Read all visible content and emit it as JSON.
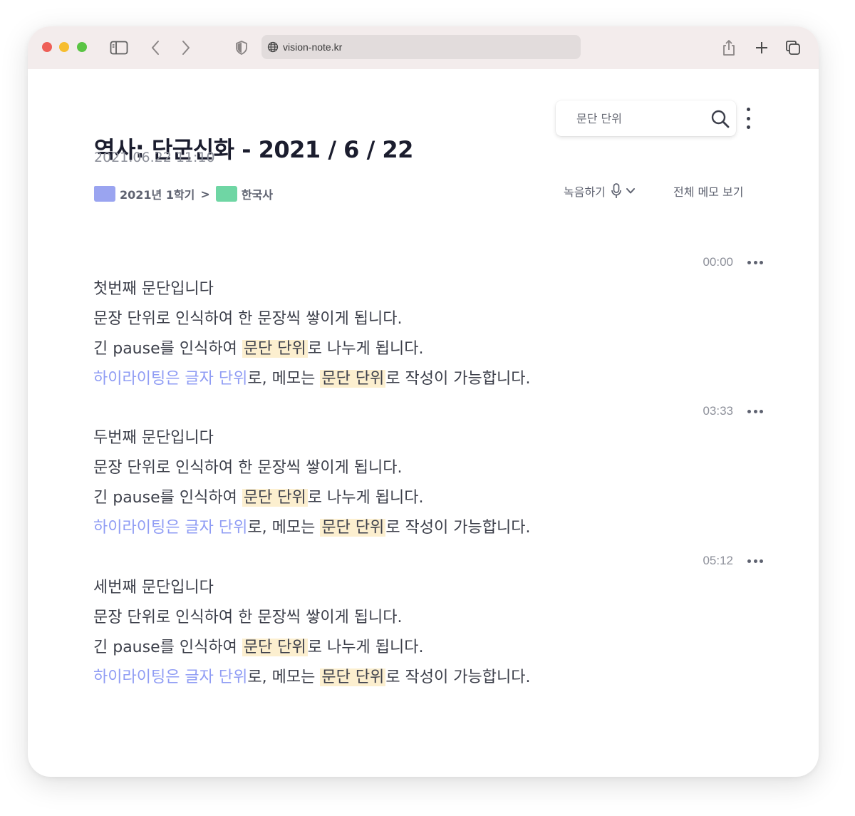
{
  "browser": {
    "url": "vision-note.kr"
  },
  "note": {
    "title": "역사: 단군신화 - 2021 / 6 / 22",
    "timestamp": "2021.06.22 11:10",
    "breadcrumb": {
      "folder1": "2021년 1학기",
      "separator": ">",
      "folder2": "한국사"
    }
  },
  "search": {
    "placeholder": "문단 단위"
  },
  "toolbar": {
    "record_label": "녹음하기",
    "all_memos_label": "전체 메모 보기"
  },
  "paragraphs": [
    {
      "time": "00:00",
      "line1": "첫번째 문단입니다",
      "line2": "문장 단위로 인식하여 한 문장씩 쌓이게 됩니다.",
      "line3a": "긴 pause를 인식하여 ",
      "line3hl": "문단 단위",
      "line3b": "로 나누게 됩니다.",
      "line4blue": "하이라이팅은 글자 단위",
      "line4a": "로, 메모는 ",
      "line4hl": "문단 단위",
      "line4b": "로 작성이 가능합니다."
    },
    {
      "time": "03:33",
      "line1": "두번째 문단입니다",
      "line2": "문장 단위로 인식하여 한 문장씩 쌓이게 됩니다.",
      "line3a": "긴 pause를 인식하여 ",
      "line3hl": "문단 단위",
      "line3b": "로 나누게 됩니다.",
      "line4blue": "하이라이팅은 글자 단위",
      "line4a": "로, 메모는 ",
      "line4hl": "문단 단위",
      "line4b": "로 작성이 가능합니다."
    },
    {
      "time": "05:12",
      "line1": "세번째 문단입니다",
      "line2": "문장 단위로 인식하여 한 문장씩 쌓이게 됩니다.",
      "line3a": "긴 pause를 인식하여 ",
      "line3hl": "문단 단위",
      "line3b": "로 나누게 됩니다.",
      "line4blue": "하이라이팅은 글자 단위",
      "line4a": "로, 메모는 ",
      "line4hl": "문단 단위",
      "line4b": "로 작성이 가능합니다."
    }
  ],
  "colors": {
    "traffic_close": "#ee5f57",
    "traffic_minimize": "#f6bd2f",
    "traffic_zoom": "#5ac444",
    "highlight_text": "#8f9cf4",
    "highlight_background": "#fcefcf",
    "folder_blue": "#9aa4f0",
    "folder_green": "#6fd6a4"
  },
  "icons": [
    "sidebar-icon",
    "back-icon",
    "forward-icon",
    "shield-icon",
    "globe-icon",
    "share-icon",
    "new-tab-icon",
    "tabs-icon",
    "search-icon",
    "more-vertical-icon",
    "folder-icon",
    "microphone-icon",
    "chevron-down-icon",
    "more-horizontal-icon"
  ]
}
